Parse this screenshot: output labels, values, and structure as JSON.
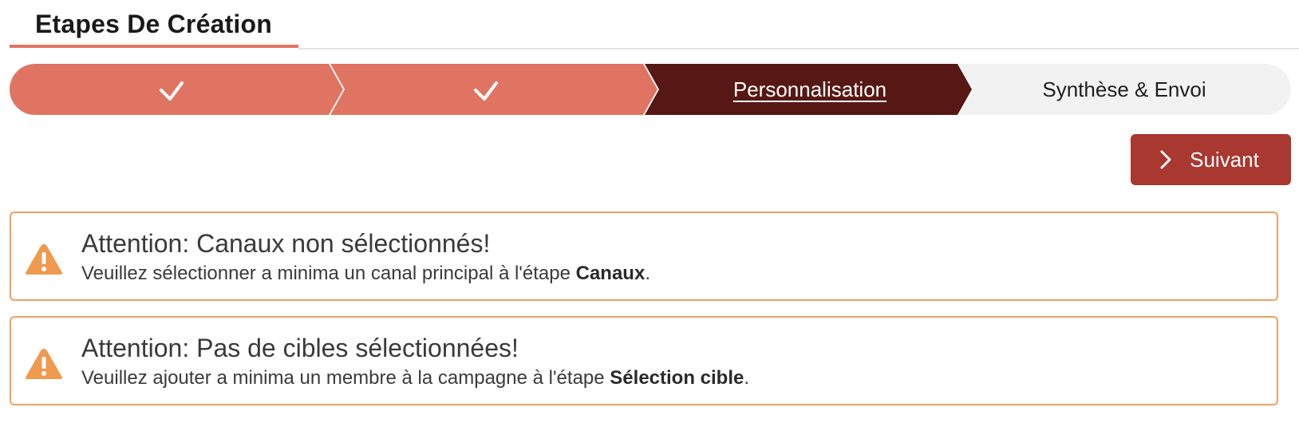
{
  "header": {
    "title": "Etapes De Création"
  },
  "stepper": {
    "steps": [
      {
        "state": "completed",
        "icon": "check-icon",
        "label": ""
      },
      {
        "state": "completed",
        "icon": "check-icon",
        "label": ""
      },
      {
        "state": "active",
        "label": "Personnalisation"
      },
      {
        "state": "upcoming",
        "label": "Synthèse & Envoi"
      }
    ],
    "colors": {
      "completed": "#e07463",
      "active": "#571815",
      "upcoming": "#f2f2f2"
    }
  },
  "actions": {
    "next_label": "Suivant",
    "next_icon": "chevron-right-icon",
    "next_color": "#a83830"
  },
  "alerts": [
    {
      "icon": "warning-icon",
      "title": "Attention: Canaux non sélectionnés!",
      "message_prefix": "Veuillez sélectionner a minima un canal principal à l'étape ",
      "message_bold": "Canaux",
      "message_suffix": "."
    },
    {
      "icon": "warning-icon",
      "title": "Attention: Pas de cibles sélectionnées!",
      "message_prefix": "Veuillez ajouter a minima un membre à la campagne à l'étape ",
      "message_bold": "Sélection cible",
      "message_suffix": "."
    }
  ],
  "theme": {
    "alert_border": "#f0a261",
    "warning_icon": "#ef9a4f"
  }
}
